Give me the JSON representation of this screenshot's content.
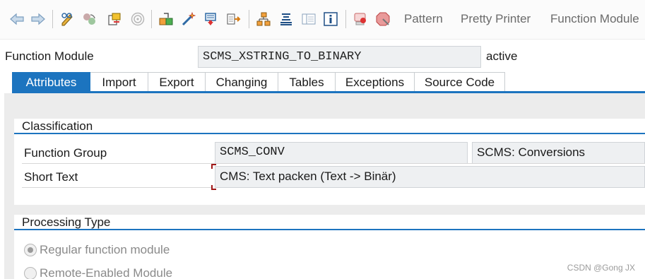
{
  "toolbar": {
    "icons": [
      "back-arrow-icon",
      "forward-arrow-icon",
      "display-change-icon",
      "active-inactive-icon",
      "other-object-icon",
      "check-icon",
      "activate-icon",
      "test-wand-icon",
      "where-used-icon",
      "navigate-icon",
      "object-list-icon",
      "hierarchy-icon",
      "display-object-list-icon",
      "info-icon",
      "breakpoint-icon",
      "stop-breakpoint-icon"
    ],
    "pattern_label": "Pattern",
    "pretty_printer_label": "Pretty Printer",
    "function_module_label": "Function Module"
  },
  "header": {
    "label": "Function Module",
    "value": "SCMS_XSTRING_TO_BINARY",
    "status": "active"
  },
  "tabs": [
    {
      "label": "Attributes",
      "active": true
    },
    {
      "label": "Import",
      "active": false
    },
    {
      "label": "Export",
      "active": false
    },
    {
      "label": "Changing",
      "active": false
    },
    {
      "label": "Tables",
      "active": false
    },
    {
      "label": "Exceptions",
      "active": false
    },
    {
      "label": "Source Code",
      "active": false
    }
  ],
  "classification": {
    "title": "Classification",
    "function_group_label": "Function Group",
    "function_group_value": "SCMS_CONV",
    "function_group_text": "SCMS: Conversions",
    "short_text_label": "Short Text",
    "short_text_value": "CMS: Text packen (Text -> Binär)"
  },
  "processing_type": {
    "title": "Processing Type",
    "options": [
      {
        "label": "Regular function module",
        "selected": true
      },
      {
        "label": "Remote-Enabled Module",
        "selected": false
      }
    ]
  },
  "watermark": "CSDN @Gong JX",
  "colors": {
    "accent": "#1c74bf",
    "field_bg": "#eef0f2",
    "required_mark": "#a01818"
  }
}
